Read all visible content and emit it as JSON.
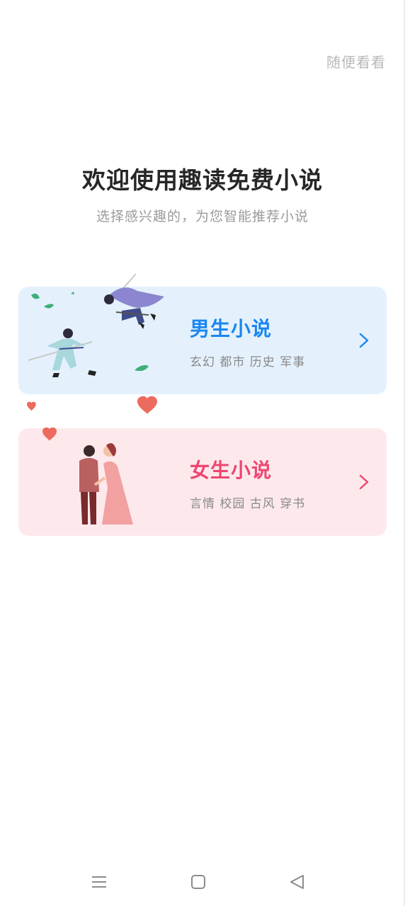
{
  "header": {
    "skip_label": "随便看看"
  },
  "welcome": {
    "title": "欢迎使用趣读免费小说",
    "subtitle": "选择感兴趣的，为您智能推荐小说"
  },
  "categories": [
    {
      "id": "male",
      "title": "男生小说",
      "genres": "玄幻 都市 历史 军事",
      "accent_color": "#1b86ef",
      "background_color": "#e4f1fd",
      "illustration": "swordsmen-duel-illustration",
      "arrow_icon": "chevron-right-icon"
    },
    {
      "id": "female",
      "title": "女生小说",
      "genres": "言情 校园 古风 穿书",
      "accent_color": "#ee4670",
      "background_color": "#fde9ec",
      "illustration": "romantic-couple-illustration",
      "arrow_icon": "chevron-right-icon"
    }
  ],
  "system_nav": {
    "buttons": [
      "menu-icon",
      "home-icon",
      "back-icon"
    ]
  }
}
